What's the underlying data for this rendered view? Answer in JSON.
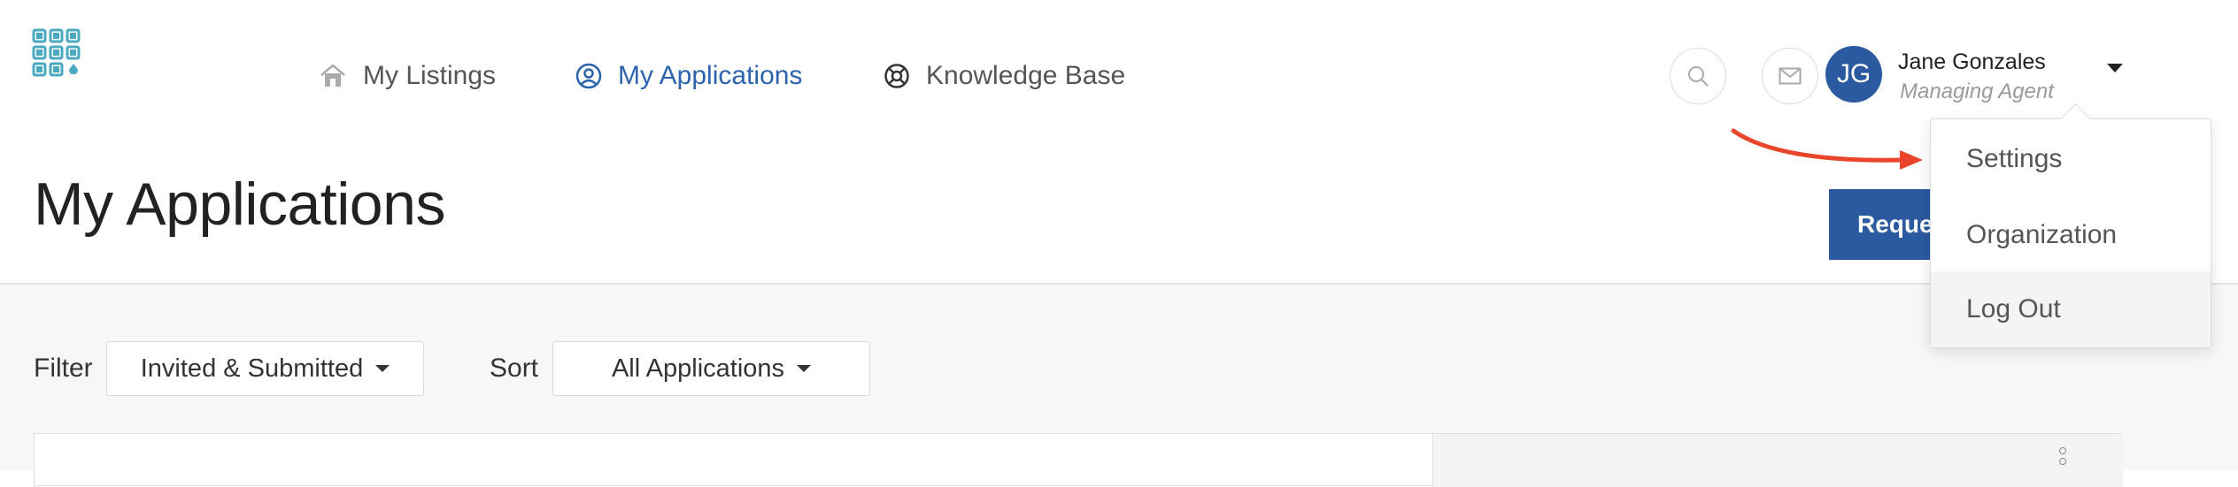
{
  "nav": {
    "items": [
      {
        "label": "My Listings",
        "icon": "home-icon",
        "active": false
      },
      {
        "label": "My Applications",
        "icon": "user-circle-icon",
        "active": true
      },
      {
        "label": "Knowledge Base",
        "icon": "lifebuoy-icon",
        "active": false
      }
    ]
  },
  "user": {
    "initials": "JG",
    "name": "Jane Gonzales",
    "role": "Managing Agent"
  },
  "page": {
    "title": "My Applications",
    "primary_button": "Request"
  },
  "filters": {
    "filter_label": "Filter",
    "filter_value": "Invited & Submitted",
    "sort_label": "Sort",
    "sort_value": "All Applications"
  },
  "user_menu": {
    "items": [
      {
        "label": "Settings"
      },
      {
        "label": "Organization"
      },
      {
        "label": "Log Out",
        "highlighted": true
      }
    ]
  },
  "colors": {
    "brand": "#2b5aa0",
    "nav_active": "#2b63ad",
    "logo": "#4aa8c0",
    "annotation_arrow": "#e8452c"
  }
}
